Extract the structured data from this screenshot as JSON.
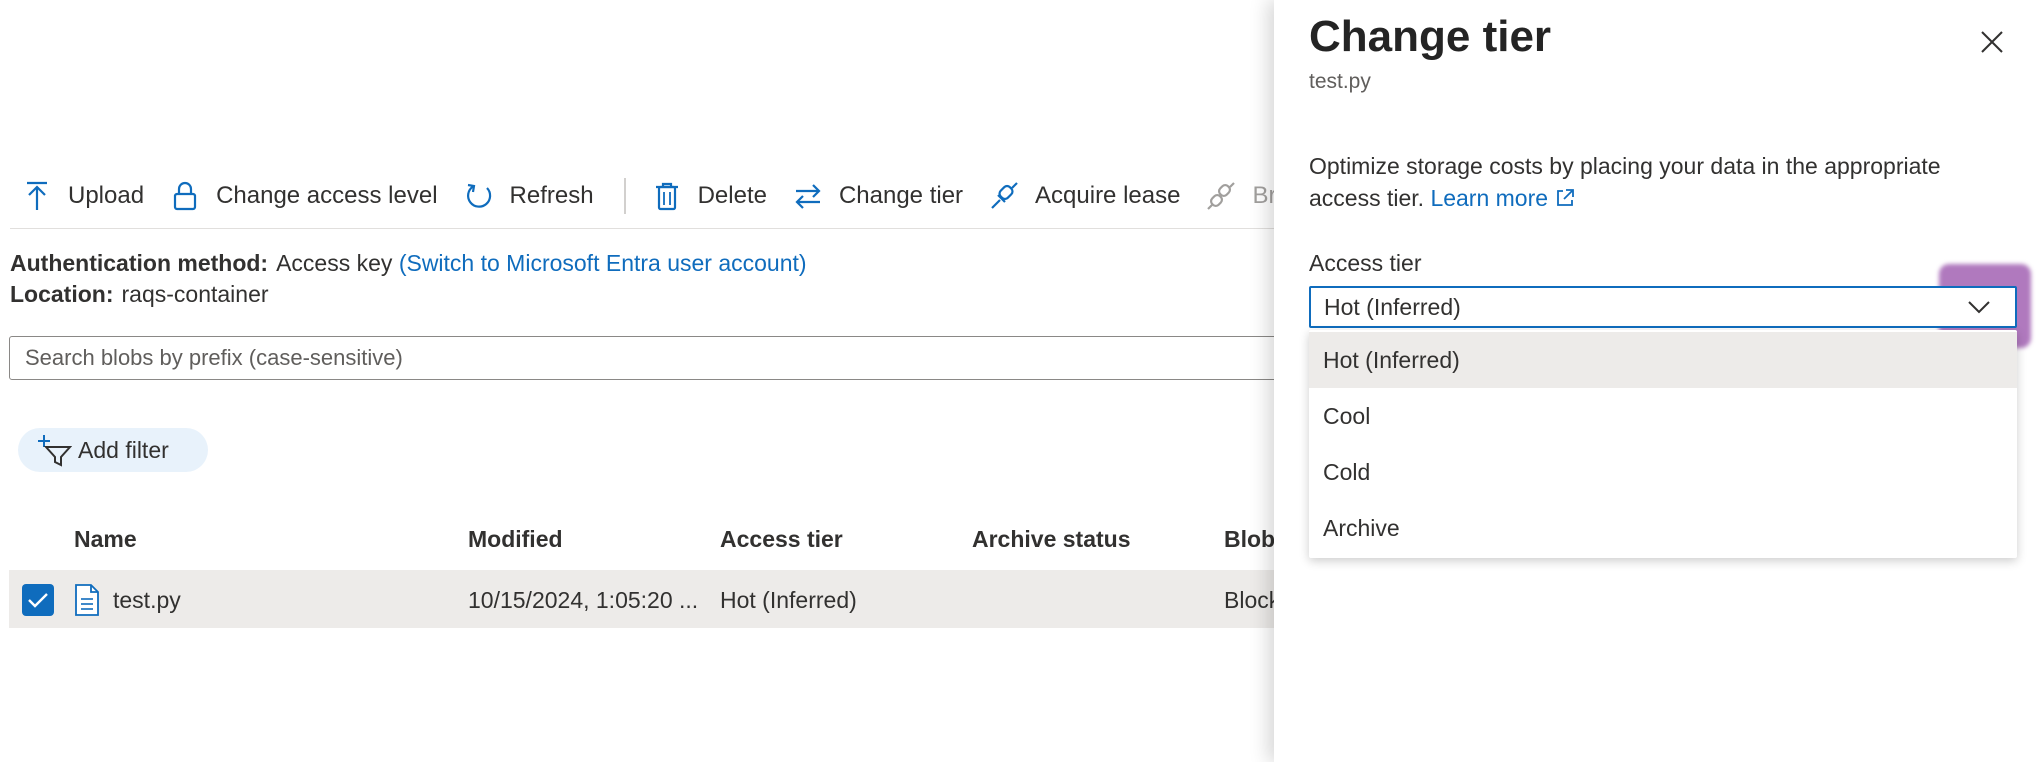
{
  "toolbar": {
    "upload": "Upload",
    "change_access_level": "Change access level",
    "refresh": "Refresh",
    "delete": "Delete",
    "change_tier": "Change tier",
    "acquire_lease": "Acquire lease",
    "break_lease": "Break"
  },
  "auth": {
    "label": "Authentication method:",
    "value": "Access key",
    "switch_link": "(Switch to Microsoft Entra user account)"
  },
  "location": {
    "label": "Location:",
    "value": "raqs-container"
  },
  "search": {
    "placeholder": "Search blobs by prefix (case-sensitive)"
  },
  "filter": {
    "add_label": "Add filter"
  },
  "table": {
    "headers": [
      "Name",
      "Modified",
      "Access tier",
      "Archive status",
      "Blob"
    ],
    "rows": [
      {
        "name": "test.py",
        "modified": "10/15/2024, 1:05:20 ...",
        "access_tier": "Hot (Inferred)",
        "archive_status": "",
        "blob_type": "Block",
        "selected": true
      }
    ]
  },
  "panel": {
    "title": "Change tier",
    "subtitle": "test.py",
    "description": "Optimize storage costs by placing your data in the appropriate access tier.",
    "learn_more": "Learn more",
    "access_tier_label": "Access tier",
    "selected_value": "Hot (Inferred)",
    "options": [
      "Hot (Inferred)",
      "Cool",
      "Cold",
      "Archive"
    ]
  },
  "colors": {
    "accent": "#0f6cbd",
    "selected_row": "#edebe9",
    "chip_bg": "#e8f2fb",
    "highlight": "#802696"
  },
  "icons": {
    "upload": "upload-icon",
    "lock": "lock-icon",
    "refresh": "refresh-icon",
    "delete": "trash-icon",
    "change_tier": "swap-arrows-icon",
    "acquire_lease": "link-icon",
    "break_lease": "broken-link-icon",
    "add_filter": "filter-add-icon",
    "file": "document-icon",
    "close": "close-icon",
    "chevron": "chevron-down-icon",
    "external": "external-link-icon"
  }
}
